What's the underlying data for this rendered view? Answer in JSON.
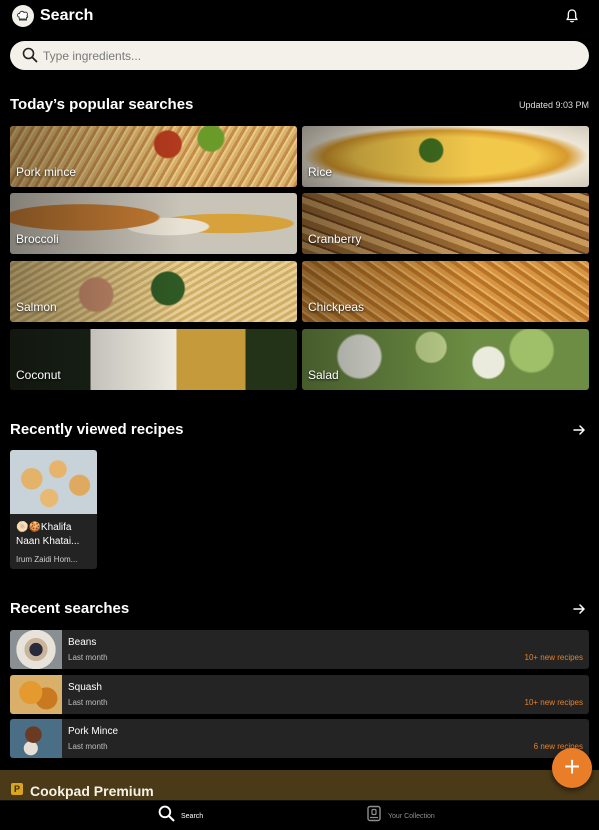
{
  "header": {
    "title": "Search"
  },
  "search": {
    "placeholder": "Type ingredients..."
  },
  "popular": {
    "title": "Today’s popular searches",
    "updated": "Updated 9:03 PM",
    "tiles": [
      {
        "label": "Pork mince"
      },
      {
        "label": "Rice"
      },
      {
        "label": "Broccoli"
      },
      {
        "label": "Cranberry"
      },
      {
        "label": "Salmon"
      },
      {
        "label": "Chickpeas"
      },
      {
        "label": "Coconut"
      },
      {
        "label": "Salad"
      }
    ]
  },
  "recently_viewed": {
    "title": "Recently viewed recipes",
    "items": [
      {
        "title": "🫓🍪Khalifa Naan Khatai...",
        "author": "Irum Zaidi Hom..."
      }
    ]
  },
  "recent_searches": {
    "title": "Recent searches",
    "items": [
      {
        "name": "Beans",
        "time": "Last month",
        "badge": "10+ new recipes"
      },
      {
        "name": "Squash",
        "time": "Last month",
        "badge": "10+ new recipes"
      },
      {
        "name": "Pork Mince",
        "time": "Last month",
        "badge": "6 new recipes"
      }
    ]
  },
  "premium": {
    "title": "Cookpad Premium",
    "icon_letter": "P"
  },
  "fab": {
    "label": "+"
  },
  "nav": {
    "search": "Search",
    "collection": "Your Collection"
  },
  "colors": {
    "accent": "#ea7d28",
    "background": "#000000",
    "card": "#242424",
    "premium_bar": "#4a3a18"
  }
}
